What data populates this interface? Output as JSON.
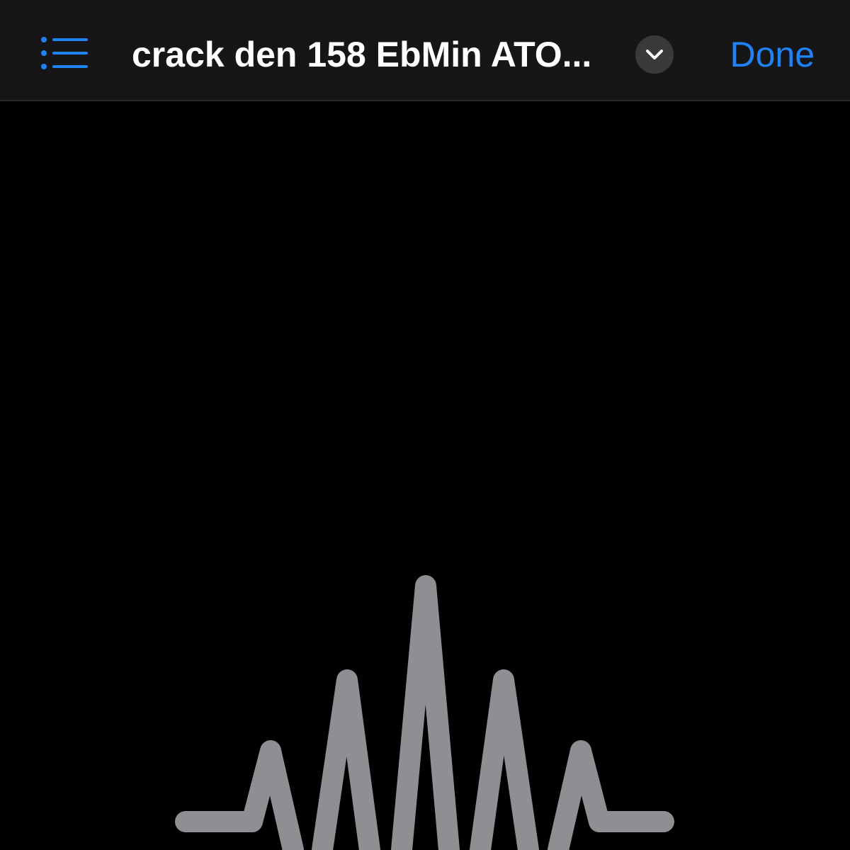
{
  "nav_bar": {
    "list_icon": "list-bullet-icon",
    "title": "crack den 158 EbMin ATO...",
    "title_menu_icon": "chevron-down-icon",
    "done_label": "Done",
    "accent_color": "#1f82f5"
  },
  "content": {
    "placeholder_icon": "audio-waveform-icon",
    "icon_color": "#8e8e93"
  }
}
